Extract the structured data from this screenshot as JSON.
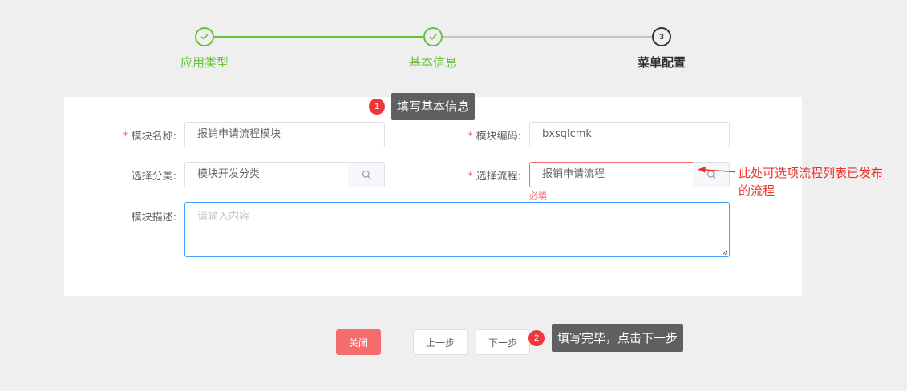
{
  "steps": [
    {
      "title": "应用类型",
      "status": "done"
    },
    {
      "title": "基本信息",
      "status": "done"
    },
    {
      "number": "3",
      "title": "菜单配置",
      "status": "current"
    }
  ],
  "form": {
    "module_name": {
      "label": "模块名称:",
      "value": "报销申请流程模块",
      "required": true
    },
    "module_code": {
      "label": "模块编码:",
      "value": "bxsqlcmk",
      "required": true
    },
    "category": {
      "label": "选择分类:",
      "value": "模块开发分类"
    },
    "process": {
      "label": "选择流程:",
      "value": "报销申请流程",
      "required": true,
      "error": "必填"
    },
    "description": {
      "label": "模块描述:",
      "placeholder": "请输入内容"
    },
    "required_mark": "*"
  },
  "buttons": {
    "close": "关闭",
    "prev": "上一步",
    "next": "下一步"
  },
  "annotations": {
    "tip1": {
      "number": "1",
      "text": "填写基本信息"
    },
    "tip2": {
      "number": "2",
      "text": "填写完毕，点击下一步"
    },
    "process_note": {
      "line1": "此处可选项流程列表已发布",
      "line2": "的流程"
    }
  },
  "colors": {
    "success": "#67c23a",
    "danger": "#f56c6c",
    "primary": "#409eff",
    "annotation": "#e8332b"
  },
  "icons": [
    "check-icon",
    "search-icon",
    "arrow-icon",
    "resize-grip-icon"
  ]
}
